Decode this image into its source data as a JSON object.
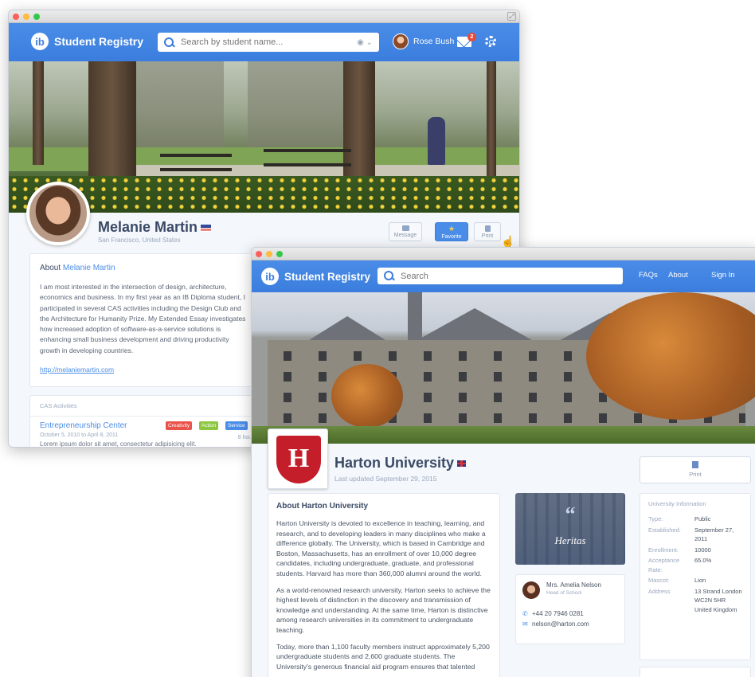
{
  "window1": {
    "app_name": "Student Registry",
    "search_placeholder": "Search by student name...",
    "user_name": "Rose Bush",
    "mail_count": "2",
    "profile": {
      "name": "Melanie Martin",
      "location": "San Francisco, United States"
    },
    "actions": {
      "message": "Message",
      "favorite": "Favorite",
      "print": "Print"
    },
    "about": {
      "title_prefix": "About",
      "title_name": "Melanie Martin",
      "text": "I am most interested in the intersection of design, architecture, economics and business. In my first year as an IB Diploma student, I participated in several CAS activities including the Design Club and the Architecture for Humanity Prize. My Extended Essay investigates how increased adoption of software-as-a-service solutions is enhancing small business development and driving productivity growth in developing countries.",
      "link": "http://melaniemartin.com"
    },
    "cas": {
      "title": "CAS Activities",
      "activity_name": "Entrepreneurship Center",
      "activity_dates": "October 5, 2010 to April 8, 2011",
      "activity_hours": "8 hours",
      "activity_desc": "Lorem ipsum dolor sit amet, consectetur adipisicing elit.",
      "tags": [
        {
          "label": "Creativity",
          "color": "#e8534a"
        },
        {
          "label": "Action",
          "color": "#8dc63f"
        },
        {
          "label": "Service",
          "color": "#4a8de8"
        }
      ]
    }
  },
  "window2": {
    "app_name": "Student Registry",
    "search_placeholder": "Search",
    "nav": {
      "faqs": "FAQs",
      "about": "About",
      "sign_in": "Sign In"
    },
    "university": {
      "name": "Harton University",
      "updated": "Last updated September 29, 2015",
      "seal_letter": "H"
    },
    "print_label": "Print",
    "about": {
      "title": "About Harton University",
      "paragraphs": [
        "Harton University is devoted to excellence in teaching, learning, and research, and to developing leaders in many disciplines who make a difference globally. The University, which is based in Cambridge and Boston, Massachusetts, has an enrollment of over 10,000 degree candidates, including undergraduate, graduate, and professional students. Harvard has more than 360,000 alumni around the world.",
        "As a world-renowned research university, Harton seeks to achieve the highest levels of distinction in the discovery and transmission of knowledge and understanding. At the same time, Harton is distinctive among research universities in its commitment to undergraduate teaching.",
        "Today, more than 1,100 faculty members instruct approximately 5,200 undergraduate students and 2,600 graduate students. The University's generous financial aid program ensures that talented"
      ]
    },
    "motto": {
      "quote_mark": "“",
      "word": "Heritas"
    },
    "contact": {
      "name": "Mrs. Amelia Nelson",
      "role": "Head of School",
      "phone": "+44 20 7946 0281",
      "email": "nelson@harton.com"
    },
    "info": {
      "title": "University Information",
      "rows": [
        {
          "k": "Type:",
          "v": "Public"
        },
        {
          "k": "Established:",
          "v": "September 27, 2011"
        },
        {
          "k": "Enrollment:",
          "v": "10000"
        },
        {
          "k": "Acceptance Rate:",
          "v": "65.0%"
        },
        {
          "k": "Mascot:",
          "v": "Lion"
        },
        {
          "k": "Address",
          "v": "13 Strand London WC2N 5HR United Kingdom"
        }
      ]
    }
  },
  "colors": {
    "accent": "#3b7ddd",
    "harton_red": "#c41e2a"
  }
}
